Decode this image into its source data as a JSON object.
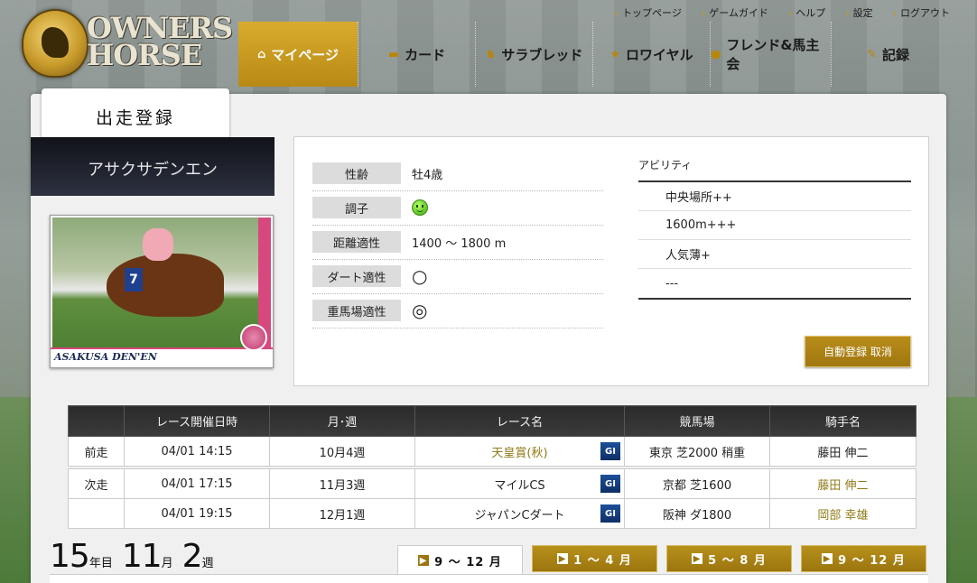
{
  "brand": {
    "logo_text": "OWNERS\nHORSE"
  },
  "util_nav": [
    "トップページ",
    "ゲームガイド",
    "ヘルプ",
    "設定",
    "ログアウト"
  ],
  "main_nav": [
    {
      "label": "マイページ",
      "icon": "home-icon",
      "active": true
    },
    {
      "label": "カード",
      "icon": "card-icon"
    },
    {
      "label": "サラブレッド",
      "icon": "horse-icon"
    },
    {
      "label": "ロワイヤル",
      "icon": "star-icon"
    },
    {
      "label": "フレンド&馬主会",
      "icon": "chat-icon"
    },
    {
      "label": "記録",
      "icon": "pencil-icon"
    }
  ],
  "section_title": "出走登録",
  "horse": {
    "name": "アサクサデンエン",
    "card_name": "ASAKUSA DEN'EN",
    "card_number": "7"
  },
  "stats": [
    {
      "label": "性齢",
      "value": "牡4歳"
    },
    {
      "label": "調子",
      "value": "",
      "icon": "smile-icon"
    },
    {
      "label": "距離適性",
      "value": "1400 〜 1800 m"
    },
    {
      "label": "ダート適性",
      "value": "○"
    },
    {
      "label": "重馬場適性",
      "value": "◎"
    }
  ],
  "ability": {
    "title": "アビリティ",
    "items": [
      "中央場所++",
      "1600m+++",
      "人気薄+",
      "---"
    ]
  },
  "auto_cancel_label": "自動登録 取消",
  "race_table": {
    "headers": [
      "",
      "レース開催日時",
      "月･週",
      "レース名",
      "競馬場",
      "騎手名"
    ],
    "rows": [
      {
        "type": "前走",
        "datetime": "04/01 14:15",
        "week": "10月4週",
        "race": "天皇賞(秋)",
        "grade": "GI",
        "course": "東京 芝2000 稍重",
        "jockey": "藤田 伸二"
      },
      {
        "type": "次走",
        "datetime": "04/01 17:15",
        "week": "11月3週",
        "race": "マイルCS",
        "grade": "GI",
        "course": "京都 芝1600",
        "jockey": "藤田 伸二"
      },
      {
        "type": "",
        "datetime": "04/01 19:15",
        "week": "12月1週",
        "race": "ジャパンCダート",
        "grade": "GI",
        "course": "阪神 ダ1800",
        "jockey": "岡部 幸雄"
      }
    ]
  },
  "period": {
    "year": "15",
    "year_unit": "年目",
    "month": "11",
    "month_unit": "月",
    "week": "2",
    "week_unit": "週"
  },
  "month_tabs": [
    {
      "label": "9 〜 12 月",
      "active": true
    },
    {
      "label": "1 〜 4 月"
    },
    {
      "label": "5 〜 8 月"
    },
    {
      "label": "9 〜 12 月"
    }
  ]
}
